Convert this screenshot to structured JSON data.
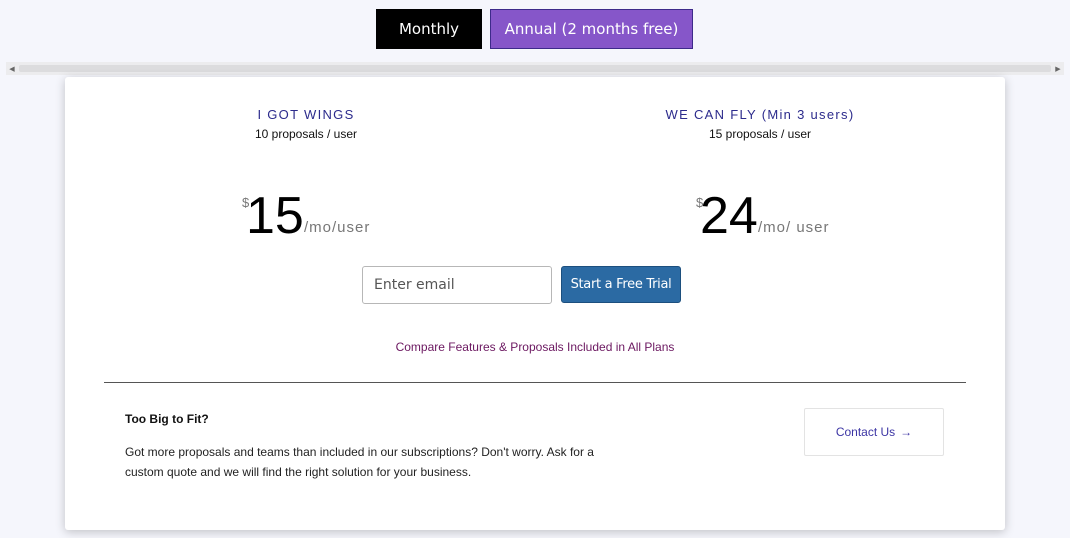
{
  "billing_toggle": {
    "monthly_label": "Monthly",
    "annual_label": "Annual (2 months free)",
    "selected": "Annual (2 months free)"
  },
  "plans": [
    {
      "name": "I GOT WINGS",
      "proposals": "10 proposals / user",
      "currency": "$",
      "price": "15",
      "period": "/mo/user"
    },
    {
      "name": "WE CAN FLY (Min 3 users)",
      "proposals": "15 proposals / user",
      "currency": "$",
      "price": "24",
      "period": "/mo/ user"
    }
  ],
  "signup": {
    "email_placeholder": "Enter email",
    "email_value": "",
    "trial_button_label": "Start a Free Trial"
  },
  "compare_link": "Compare Features & Proposals Included in All Plans",
  "enterprise": {
    "title": "Too Big to Fit?",
    "description": "Got more proposals and teams than included in our subscriptions? Don't worry. Ask for a custom quote and we will find the right solution for your business.",
    "contact_label": "Contact Us"
  },
  "icons": {
    "contact_arrow": "arrow-right-icon",
    "scroll_left": "triangle-left-icon",
    "scroll_right": "triangle-right-icon"
  },
  "colors": {
    "monthly_bg": "#000000",
    "annual_bg": "#8656c9",
    "trial_button_bg": "#2b6aa3",
    "plan_name": "#2c2b8c",
    "compare_link": "#6b1760"
  }
}
